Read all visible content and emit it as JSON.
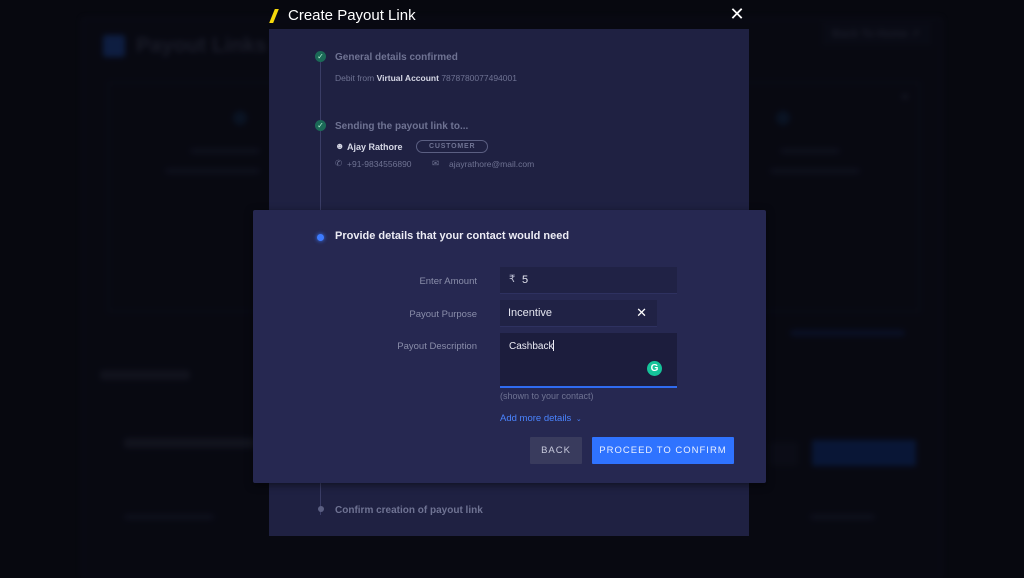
{
  "background": {
    "page_title": "Payout Links",
    "back_button": "Back To Home ↗"
  },
  "modal": {
    "title": "Create Payout Link",
    "close_icon": "close-icon",
    "steps": [
      {
        "status": "done",
        "title": "General details confirmed",
        "detail_prefix": "Debit from",
        "detail_account_type": "Virtual Account",
        "detail_account_number": "7878780077494001"
      },
      {
        "status": "done",
        "title": "Sending the payout link to...",
        "contact_name": "Ajay Rathore",
        "contact_badge": "CUSTOMER",
        "phone": "+91-9834556890",
        "email": "ajayrathore@mail.com"
      },
      {
        "status": "active",
        "title": "Provide details that your contact would need"
      },
      {
        "status": "pending",
        "title": "Confirm creation of payout link"
      }
    ],
    "form": {
      "amount_label": "Enter Amount",
      "currency_symbol": "₹",
      "amount_value": "5",
      "purpose_label": "Payout Purpose",
      "purpose_value": "Incentive",
      "description_label": "Payout Description",
      "description_value": "Cashback",
      "description_hint": "(shown to your contact)",
      "add_more_label": "Add more details",
      "back_button": "BACK",
      "proceed_button": "PROCEED TO CONFIRM"
    },
    "colors": {
      "accent": "#2f73ff",
      "brand": "#f5d80b",
      "success": "#1b6a57",
      "grammarly": "#15c39a"
    }
  }
}
